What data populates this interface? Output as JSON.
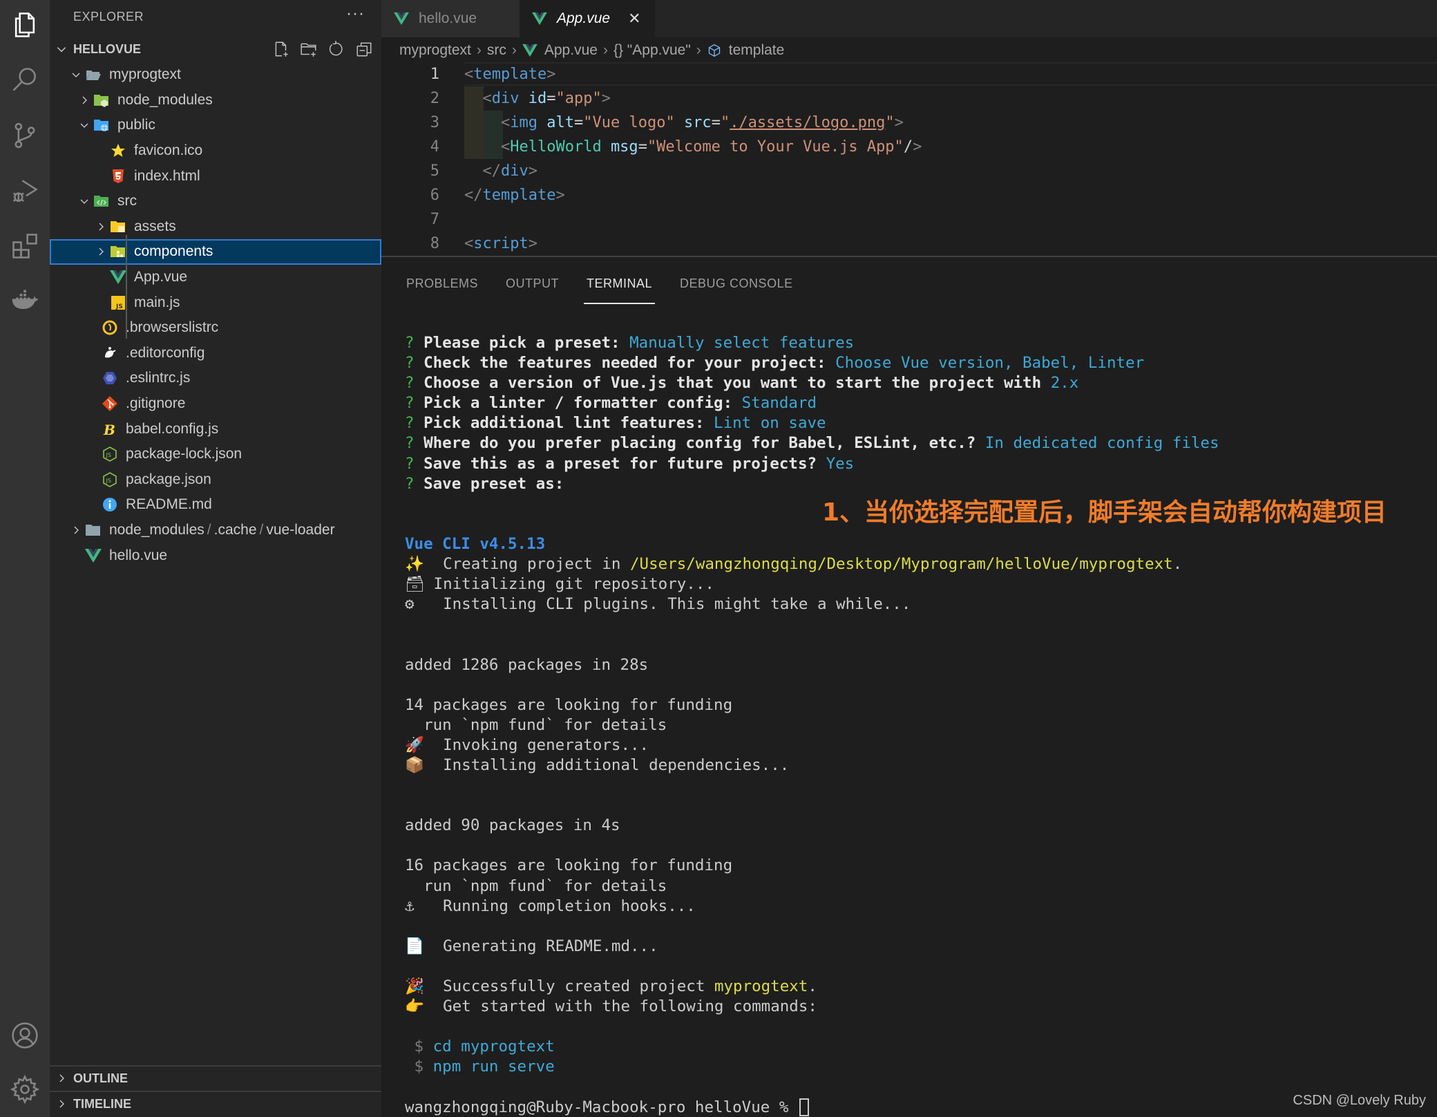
{
  "activity_bar": {
    "items": [
      {
        "name": "explorer",
        "icon": "files-icon",
        "active": true
      },
      {
        "name": "search",
        "icon": "search-icon"
      },
      {
        "name": "source-control",
        "icon": "source-control-icon"
      },
      {
        "name": "run-debug",
        "icon": "run-debug-icon"
      },
      {
        "name": "extensions",
        "icon": "extensions-icon"
      },
      {
        "name": "docker",
        "icon": "docker-icon"
      }
    ],
    "bottom": [
      {
        "name": "accounts",
        "icon": "account-icon"
      },
      {
        "name": "manage",
        "icon": "gear-icon"
      }
    ]
  },
  "sidebar": {
    "title": "EXPLORER",
    "more": "···",
    "workspace": "HELLOVUE",
    "tree": [
      {
        "label": "myprogtext",
        "depth": 0,
        "type": "folder",
        "expanded": true,
        "icon": "folder-open-icon"
      },
      {
        "label": "node_modules",
        "depth": 1,
        "type": "folder",
        "expanded": false,
        "icon": "node-folder-icon"
      },
      {
        "label": "public",
        "depth": 1,
        "type": "folder",
        "expanded": true,
        "icon": "public-folder-icon"
      },
      {
        "label": "favicon.ico",
        "depth": 2,
        "type": "file",
        "icon": "star-icon"
      },
      {
        "label": "index.html",
        "depth": 2,
        "type": "file",
        "icon": "html5-icon"
      },
      {
        "label": "src",
        "depth": 1,
        "type": "folder",
        "expanded": true,
        "icon": "src-folder-icon"
      },
      {
        "label": "assets",
        "depth": 2,
        "type": "folder",
        "expanded": false,
        "icon": "assets-folder-icon"
      },
      {
        "label": "components",
        "depth": 2,
        "type": "folder",
        "expanded": false,
        "icon": "components-folder-icon",
        "selected": true
      },
      {
        "label": "App.vue",
        "depth": 2,
        "type": "file",
        "icon": "vue-icon"
      },
      {
        "label": "main.js",
        "depth": 2,
        "type": "file",
        "icon": "js-icon"
      },
      {
        "label": ".browserslistrc",
        "depth": 1,
        "type": "file",
        "icon": "browserslist-icon"
      },
      {
        "label": ".editorconfig",
        "depth": 1,
        "type": "file",
        "icon": "editorconfig-icon"
      },
      {
        "label": ".eslintrc.js",
        "depth": 1,
        "type": "file",
        "icon": "eslint-icon"
      },
      {
        "label": ".gitignore",
        "depth": 1,
        "type": "file",
        "icon": "git-icon"
      },
      {
        "label": "babel.config.js",
        "depth": 1,
        "type": "file",
        "icon": "babel-icon"
      },
      {
        "label": "package-lock.json",
        "depth": 1,
        "type": "file",
        "icon": "nodejs-icon"
      },
      {
        "label": "package.json",
        "depth": 1,
        "type": "file",
        "icon": "nodejs-icon"
      },
      {
        "label": "README.md",
        "depth": 1,
        "type": "file",
        "icon": "info-icon"
      }
    ],
    "compact_folder": [
      "node_modules",
      ".cache",
      "vue-loader"
    ],
    "root_file": "hello.vue",
    "outline": "OUTLINE",
    "timeline": "TIMELINE"
  },
  "tabs": [
    {
      "label": "hello.vue",
      "active": false
    },
    {
      "label": "App.vue",
      "active": true,
      "close": "✕"
    }
  ],
  "breadcrumb": {
    "items": [
      "myprogtext",
      "src",
      "App.vue",
      "{} \"App.vue\"",
      "template"
    ],
    "sep": "›"
  },
  "editor": {
    "line_numbers": [
      "1",
      "2",
      "3",
      "4",
      "5",
      "6",
      "7",
      "8"
    ],
    "current_line": 1,
    "lines": [
      [
        [
          "<",
          "punct"
        ],
        [
          "template",
          "tag"
        ],
        [
          ">",
          "punct"
        ]
      ],
      [
        [
          "  ",
          "ws"
        ],
        [
          "<",
          "punct"
        ],
        [
          "div",
          "tag"
        ],
        [
          " ",
          "ws"
        ],
        [
          "id",
          "attr"
        ],
        [
          "=",
          "eq"
        ],
        [
          "\"app\"",
          "str"
        ],
        [
          ">",
          "punct"
        ]
      ],
      [
        [
          "    ",
          "ws"
        ],
        [
          "<",
          "punct"
        ],
        [
          "img",
          "tag"
        ],
        [
          " ",
          "ws"
        ],
        [
          "alt",
          "attr"
        ],
        [
          "=",
          "eq"
        ],
        [
          "\"Vue logo\"",
          "str"
        ],
        [
          " ",
          "ws"
        ],
        [
          "src",
          "attr"
        ],
        [
          "=",
          "eq"
        ],
        [
          "\"",
          "str"
        ],
        [
          "./assets/logo.png",
          "link"
        ],
        [
          "\"",
          "str"
        ],
        [
          ">",
          "punct"
        ]
      ],
      [
        [
          "    ",
          "ws"
        ],
        [
          "<",
          "punct"
        ],
        [
          "HelloWorld",
          "comp"
        ],
        [
          " ",
          "ws"
        ],
        [
          "msg",
          "attr"
        ],
        [
          "=",
          "eq"
        ],
        [
          "\"Welcome to Your Vue.js App\"",
          "str"
        ],
        [
          "/",
          "eq"
        ],
        [
          ">",
          "punct"
        ]
      ],
      [
        [
          "  ",
          "ws"
        ],
        [
          "</",
          "punct"
        ],
        [
          "div",
          "tag"
        ],
        [
          ">",
          "punct"
        ]
      ],
      [
        [
          "</",
          "punct"
        ],
        [
          "template",
          "tag"
        ],
        [
          ">",
          "punct"
        ]
      ],
      [],
      [
        [
          "<",
          "punct"
        ],
        [
          "script",
          "tag"
        ],
        [
          ">",
          "punct"
        ]
      ]
    ]
  },
  "panel": {
    "tabs": [
      "PROBLEMS",
      "OUTPUT",
      "TERMINAL",
      "DEBUG CONSOLE"
    ],
    "active_tab": "TERMINAL"
  },
  "terminal": {
    "prompts": [
      {
        "q": "?",
        "label": "Please pick a preset:",
        "answer": "Manually select features"
      },
      {
        "q": "?",
        "label": "Check the features needed for your project:",
        "answer": "Choose Vue version, Babel, Linter"
      },
      {
        "q": "?",
        "label": "Choose a version of Vue.js that you want to start the project with",
        "answer": "2.x"
      },
      {
        "q": "?",
        "label": "Pick a linter / formatter config:",
        "answer": "Standard"
      },
      {
        "q": "?",
        "label": "Pick additional lint features:",
        "answer": "Lint on save"
      },
      {
        "q": "?",
        "label": "Where do you prefer placing config for Babel, ESLint, etc.?",
        "answer": "In dedicated config files"
      },
      {
        "q": "?",
        "label": "Save this as a preset for future projects?",
        "answer": "Yes"
      },
      {
        "q": "?",
        "label": "Save preset as:",
        "answer": ""
      }
    ],
    "cli_version": "Vue CLI v4.5.13",
    "creating": {
      "emoji": "✨",
      "text": "  Creating project in ",
      "path": "/Users/wangzhongqing/Desktop/Myprogram/helloVue/myprogtext",
      "end": "."
    },
    "init_git": {
      "emoji": "🗃",
      "text": " Initializing git repository..."
    },
    "install_plugins": {
      "emoji": "⚙",
      "text": "  Installing CLI plugins. This might take a while..."
    },
    "added1": "added 1286 packages in 28s",
    "funding1": "14 packages are looking for funding",
    "fund_hint1": "  run `npm fund` for details",
    "invoking": {
      "emoji": "🚀",
      "text": "  Invoking generators..."
    },
    "installing_deps": {
      "emoji": "📦",
      "text": "  Installing additional dependencies..."
    },
    "added2": "added 90 packages in 4s",
    "funding2": "16 packages are looking for funding",
    "fund_hint2": "  run `npm fund` for details",
    "hooks": {
      "emoji": "⚓",
      "text": "  Running completion hooks..."
    },
    "readme": {
      "emoji": "📄",
      "text": "  Generating README.md..."
    },
    "success": {
      "emoji": "🎉",
      "text": "  Successfully created project ",
      "project": "myprogtext",
      "end": "."
    },
    "get_started": {
      "emoji": "👉",
      "text": "  Get started with the following commands:"
    },
    "commands": [
      {
        "prompt": " $ ",
        "cmd": "cd myprogtext"
      },
      {
        "prompt": " $ ",
        "cmd": "npm run serve"
      }
    ],
    "shell_prompt": "wangzhongqing@Ruby-Macbook-pro helloVue % "
  },
  "annotation": "1、当你选择完配置后，脚手架会自动帮你构建项目",
  "watermark": "CSDN @Lovely Ruby",
  "colors": {
    "accent_selection": "#04395e",
    "vue_green": "#41b883",
    "annotation_orange": "#f07c2a",
    "terminal_cyan": "#3fa9d6",
    "terminal_yellow": "#dcdc4a"
  }
}
